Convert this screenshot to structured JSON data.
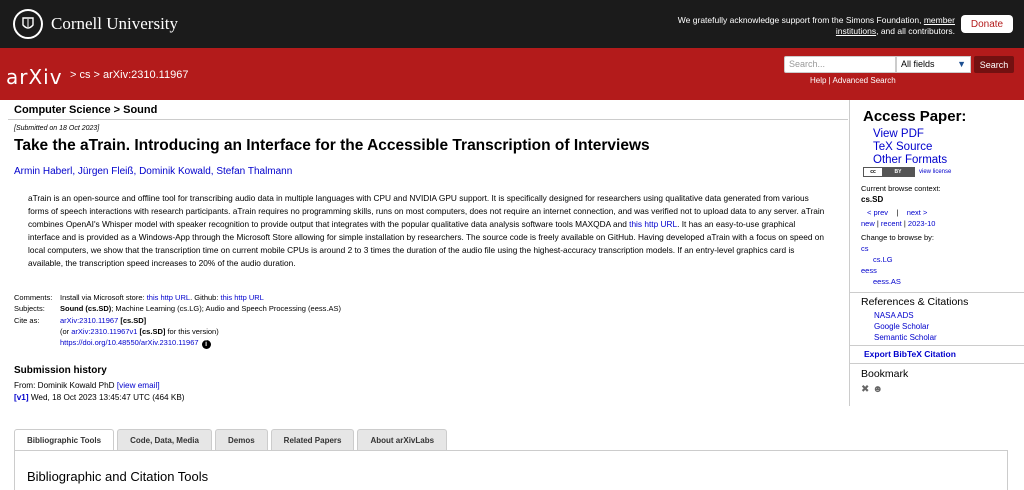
{
  "cornell": {
    "name": "Cornell University",
    "ack_line1": "We gratefully acknowledge support from the Simons Foundation,",
    "ack_link1": "member",
    "ack_link2": "institutions",
    "ack_line2": ", and all contributors.",
    "donate": "Donate"
  },
  "arxiv": {
    "logo": "arXiv",
    "breadcrumb": "> cs > arXiv:2310.11967",
    "search_placeholder": "Search...",
    "search_field": "All fields",
    "search_button": "Search",
    "help": "Help",
    "advanced_search": "Advanced Search",
    "help_sep": " | "
  },
  "paper": {
    "section": "Computer Science > Sound",
    "submitted": "[Submitted on 18 Oct 2023]",
    "title": "Take the aTrain. Introducing an Interface for the Accessible Transcription of Interviews",
    "authors": [
      "Armin Haberl",
      "Jürgen Fleiß",
      "Dominik Kowald",
      "Stefan Thalmann"
    ],
    "abstract_p1": "aTrain is an open-source and offline tool for transcribing audio data in multiple languages with CPU and NVIDIA GPU support. It is specifically designed for researchers using qualitative data generated from various forms of speech interactions with research participants. aTrain requires no programming skills, runs on most computers, does not require an internet connection, and was verified not to upload data to any server. aTrain combines OpenAI's Whisper model with speaker recognition to provide output that integrates with the popular qualitative data analysis software tools MAXQDA and ",
    "abstract_link": "this http URL",
    "abstract_p2": ". It has an easy-to-use graphical interface and is provided as a Windows-App through the Microsoft Store allowing for simple installation by researchers. The source code is freely available on GitHub. Having developed aTrain with a focus on speed on local computers, we show that the transcription time on current mobile CPUs is around 2 to 3 times the duration of the audio file using the highest-accuracy transcription models. If an entry-level graphics card is available, the transcription speed increases to 20% of the audio duration."
  },
  "meta": {
    "comments_label": "Comments:",
    "comments_text1": "Install via Microsoft store: ",
    "comments_link1": "this http URL",
    "comments_text2": ". Github: ",
    "comments_link2": "this http URL",
    "subjects_label": "Subjects:",
    "subjects_bold": "Sound (cs.SD)",
    "subjects_rest": "; Machine Learning (cs.LG); Audio and Speech Processing (eess.AS)",
    "cite_label": "Cite as:",
    "cite_id": "arXiv:2310.11967",
    "cite_tag": "[cs.SD]",
    "cite_or": "(or ",
    "cite_v1": "arXiv:2310.11967v1",
    "cite_v1_tag": "[cs.SD]",
    "cite_v1_rest": " for this version)",
    "doi": "https://doi.org/10.48550/arXiv.2310.11967",
    "info": "i"
  },
  "history": {
    "title": "Submission history",
    "from_text": "From: Dominik Kowald PhD ",
    "view_email": "[view email]",
    "v1": "[v1]",
    "v1_text": " Wed, 18 Oct 2023 13:45:47 UTC (464 KB)"
  },
  "tabs": [
    "Bibliographic Tools",
    "Code, Data, Media",
    "Demos",
    "Related Papers",
    "About arXivLabs"
  ],
  "tab_panel_title": "Bibliographic and Citation Tools",
  "sidebar": {
    "access_title": "Access Paper:",
    "access_links": [
      "View PDF",
      "TeX Source",
      "Other Formats"
    ],
    "cc_a": "cc",
    "cc_b": "BY",
    "view_license": "view license",
    "browse_context": "Current browse context:",
    "browse_cat": "cs.SD",
    "prev": "< prev",
    "sep": "|",
    "next": "next >",
    "new": "new",
    "recent": "recent",
    "month": "2023-10",
    "change_browse": "Change to browse by:",
    "browse_items": [
      {
        "label": "cs",
        "indent": false
      },
      {
        "label": "cs.LG",
        "indent": true
      },
      {
        "label": "eess",
        "indent": false
      },
      {
        "label": "eess.AS",
        "indent": true
      }
    ],
    "refs_title": "References & Citations",
    "refs_links": [
      "NASA ADS",
      "Google Scholar",
      "Semantic Scholar"
    ],
    "bibtex": "Export BibTeX Citation",
    "bookmark_title": "Bookmark",
    "bookmark_icons": [
      "bibsonomy-icon",
      "reddit-icon"
    ]
  }
}
